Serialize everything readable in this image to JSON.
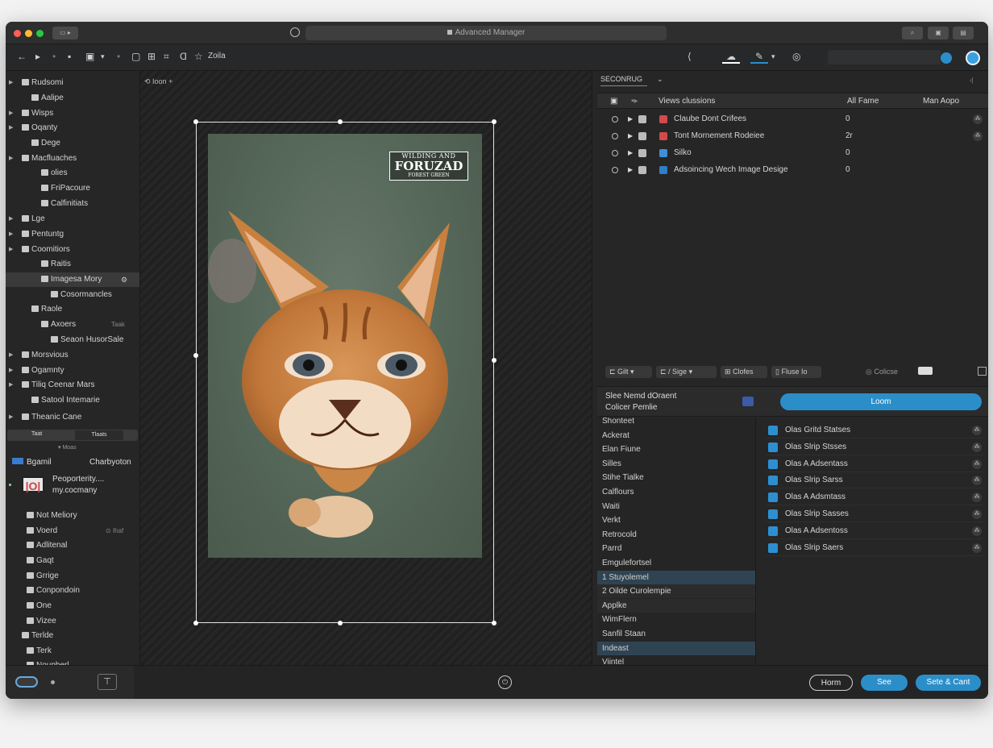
{
  "window": {
    "title": "Advanced Manager"
  },
  "toolbar": {
    "zoom_label": "Zoila"
  },
  "sidebar": {
    "items": [
      {
        "label": "Rudsomi",
        "indent": 0,
        "arrow": true
      },
      {
        "label": "Aalipe",
        "indent": 1
      },
      {
        "label": "Wisps",
        "indent": 0,
        "arrow": true
      },
      {
        "label": "Oqanty",
        "indent": 0,
        "arrow": true
      },
      {
        "label": "Dege",
        "indent": 1
      },
      {
        "label": "Macfluaches",
        "indent": 0,
        "arrow": true
      },
      {
        "label": "olies",
        "indent": 2
      },
      {
        "label": "FriPacoure",
        "indent": 2
      },
      {
        "label": "Calfinitiats",
        "indent": 2
      },
      {
        "label": "Lge",
        "indent": 0,
        "arrow": true
      },
      {
        "label": "Pentuntg",
        "indent": 0,
        "arrow": true
      },
      {
        "label": "Coomitiors",
        "indent": 0,
        "arrow": true
      },
      {
        "label": "Raitis",
        "indent": 2
      },
      {
        "label": "Imagesa Mory",
        "indent": 2,
        "selected": true
      },
      {
        "label": "Cosormancles",
        "indent": 3
      },
      {
        "label": "Raole",
        "indent": 1
      },
      {
        "label": "Axoers",
        "indent": 2,
        "badge": "Taak"
      },
      {
        "label": "Seaon HusorSale",
        "indent": 3
      },
      {
        "label": "Morsvious",
        "indent": 0,
        "arrow": true
      },
      {
        "label": "Ogamnty",
        "indent": 0,
        "arrow": true
      },
      {
        "label": "Tiliq Ceenar Mars",
        "indent": 0,
        "arrow": true
      },
      {
        "label": "Satool Intemarie",
        "indent": 1
      },
      {
        "label": "Theanic Cane",
        "indent": 0,
        "arrow": true
      }
    ],
    "tabs": [
      "Taat",
      "Tlaats"
    ],
    "tabs_caption": "Moas",
    "account": {
      "left": "Bgamil",
      "right": "Charbyoton"
    },
    "promo": {
      "line1": "Peoporterity....",
      "line2": "my.cocmany"
    },
    "items2": [
      {
        "label": "Not Meliory"
      },
      {
        "label": "Voerd",
        "badge": "Ihaf"
      },
      {
        "label": "Adlitenal"
      },
      {
        "label": "Gaqt"
      },
      {
        "label": "Grrige"
      },
      {
        "label": "Conpondoin"
      },
      {
        "label": "One"
      },
      {
        "label": "Vizee"
      },
      {
        "label": "Terlde"
      },
      {
        "label": "Terk"
      },
      {
        "label": "Noupberl"
      }
    ]
  },
  "canvas": {
    "label": "Ioon",
    "stamp": {
      "line1": "WILDING AND",
      "line2": "FORUZAD",
      "line3": "FOREST GREEN"
    }
  },
  "rightpanel": {
    "tab": "SECONRUG",
    "columns": [
      "Views clussions",
      "All Fame",
      "Man Aopo"
    ],
    "rows": [
      {
        "label": "Claube Dont Crifees",
        "value": "0",
        "color": "#d44a4a"
      },
      {
        "label": "Tont Mornement Rodeiee",
        "value": "2r",
        "color": "#d44a4a"
      },
      {
        "label": "Silko",
        "value": "0",
        "color": "#3f8fd8"
      },
      {
        "label": "Adsoincing Wech Image Desige",
        "value": "0",
        "color": "#2d7fc7"
      }
    ],
    "filters": {
      "a": "Gilt",
      "b": "Sige",
      "c": "Clofes",
      "d": "Fluse Io",
      "e": "Colicse"
    },
    "detail": {
      "line1": "Slee Nemd dOraent",
      "line2": "Colicer Pemlie",
      "learn_label": "Loom"
    },
    "left_list": [
      "Shonteet",
      "Ackerat",
      "Elan Fiune",
      "Silles",
      "Stihe Tialke",
      "Calflours",
      "Waiti",
      "Verkt",
      "Retrocold",
      "Parrd",
      "Emgulefortsel",
      "1 Stuyolemel",
      "2 Oilde Curolempie",
      "Applke",
      "WimFlern",
      "Sanfil Staan",
      "Indeast",
      "Viintel"
    ],
    "right_list": [
      "Olas Gritd Statses",
      "Olas Slrip Stsses",
      "Olas A Adsentass",
      "Olas Slrip Sarss",
      "Olas A Adsmtass",
      "Olas Slrip Sasses",
      "Olas A Adsentoss",
      "Olas Slrip Saers"
    ]
  },
  "bottom": {
    "cancel": "Horm",
    "save": "See",
    "save_close": "Sete & Cant"
  }
}
